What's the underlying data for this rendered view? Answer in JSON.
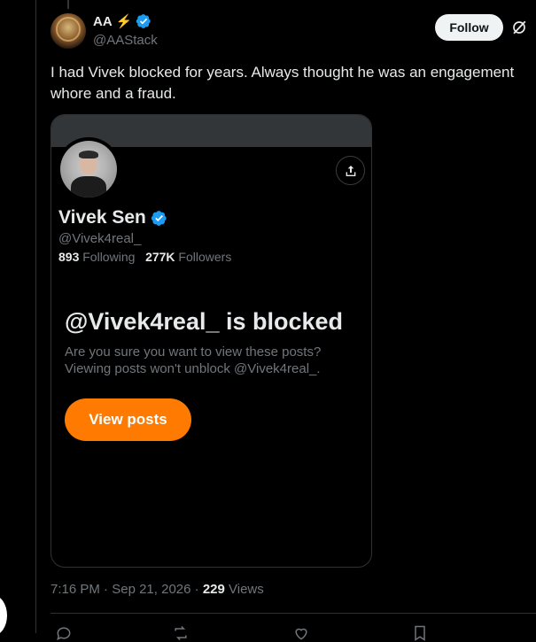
{
  "tweet": {
    "author": {
      "display_name": "AA",
      "emoji": "⚡",
      "handle": "@AAStack",
      "verified": true
    },
    "follow_label": "Follow",
    "text": "I had Vivek blocked for years. Always thought he was an engagement whore and a fraud.",
    "time": "7:16 PM",
    "date": "Sep 21, 2026",
    "views_count": "229",
    "views_label": "Views"
  },
  "media": {
    "profile_name": "Vivek Sen",
    "profile_handle": "@Vivek4real_",
    "following_count": "893",
    "following_label": "Following",
    "followers_count": "277K",
    "followers_label": "Followers",
    "blocked_title": "@Vivek4real_ is blocked",
    "blocked_desc_line1": "Are you sure you want to view these posts?",
    "blocked_desc_line2": "Viewing posts won't unblock @Vivek4real_.",
    "view_button": "View posts"
  },
  "actions": [
    "reply-icon",
    "repost-icon",
    "like-icon",
    "bookmark-icon"
  ],
  "colors": {
    "verified": "#1d9bf0",
    "accent_orange": "#ff7a00",
    "background": "#000000"
  }
}
